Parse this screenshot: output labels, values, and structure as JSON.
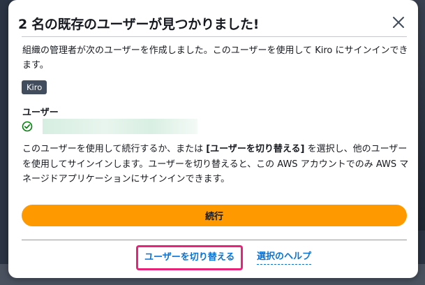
{
  "modal": {
    "title": "2 名の既存のユーザーが見つかりました!",
    "description": "組織の管理者が次のユーザーを作成しました。このユーザーを使用して Kiro にサインインできます。",
    "badge": "Kiro",
    "user_heading": "ユーザー",
    "body_part1": "このユーザーを使用して続行するか、または ",
    "body_bold": "[ユーザーを切り替える]",
    "body_part2": " を選択し、他のユーザーを使用してサインインします。ユーザーを切り替えると、この AWS アカウントでのみ AWS マネージドアプリケーションにサインインできます。",
    "continue_label": "続行",
    "switch_user_label": "ユーザーを切り替える",
    "help_label": "選択のヘルプ"
  },
  "colors": {
    "primary_button": "#ff9900",
    "link": "#0972d3",
    "highlight_border": "#e6257a",
    "success_icon": "#037f0c",
    "badge_bg": "#414d5c"
  },
  "icons": {
    "close": "close-icon",
    "check": "check-circle-icon"
  }
}
